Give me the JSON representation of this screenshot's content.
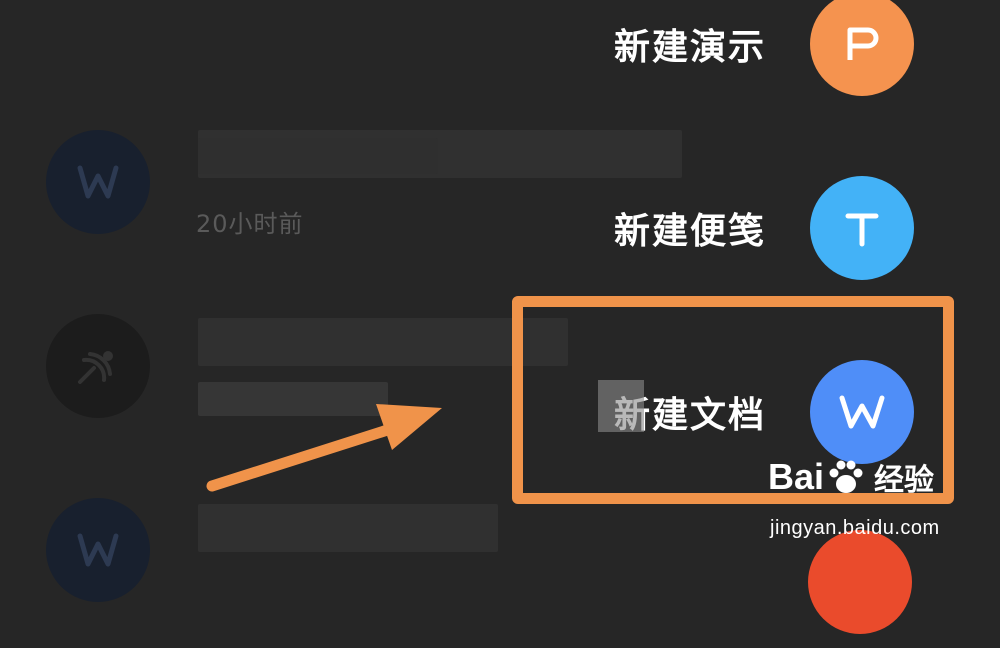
{
  "file_list": {
    "items": [
      {
        "icon": "word-icon",
        "time": "20小时前"
      },
      {
        "icon": "satellite-dish-icon",
        "time": ""
      },
      {
        "icon": "word-icon",
        "time": ""
      }
    ]
  },
  "menu": {
    "items": [
      {
        "label": "新建演示",
        "icon": "presentation-icon",
        "glyph": "P",
        "color": "#f5934f"
      },
      {
        "label": "新建便笺",
        "icon": "note-icon",
        "glyph": "T",
        "color": "#43b2f7"
      },
      {
        "label": "新建文档",
        "icon": "document-icon",
        "glyph": "W",
        "color": "#4f8ef8"
      }
    ]
  },
  "watermark": {
    "brand": "Bai",
    "brand_suffix": "经验",
    "url": "jingyan.baidu.com"
  },
  "colors": {
    "highlight": "#f0934a",
    "arrow": "#f0934a",
    "background": "#262626",
    "fab_bottom": "#ea4b2c"
  }
}
